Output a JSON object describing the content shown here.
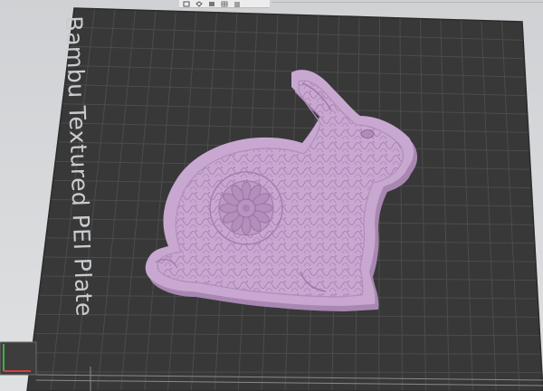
{
  "plate": {
    "name": "Bambu Textured PEI Plate"
  },
  "colors": {
    "background": "#d9dadc",
    "plate": "#3a3a3a",
    "grid_line": "#4e4e4e",
    "model": "#c8a8d0",
    "model_shadow": "#a987b3",
    "plate_label": "#c9ccd0",
    "axis_x": "#d04040",
    "axis_y": "#40b040"
  },
  "toolbar": {
    "icons": [
      "cube-view-icon",
      "iso-view-icon",
      "top-view-icon",
      "grid-toggle-icon",
      "layers-icon"
    ]
  },
  "model": {
    "description_icon": "rabbit-mandala-model"
  }
}
